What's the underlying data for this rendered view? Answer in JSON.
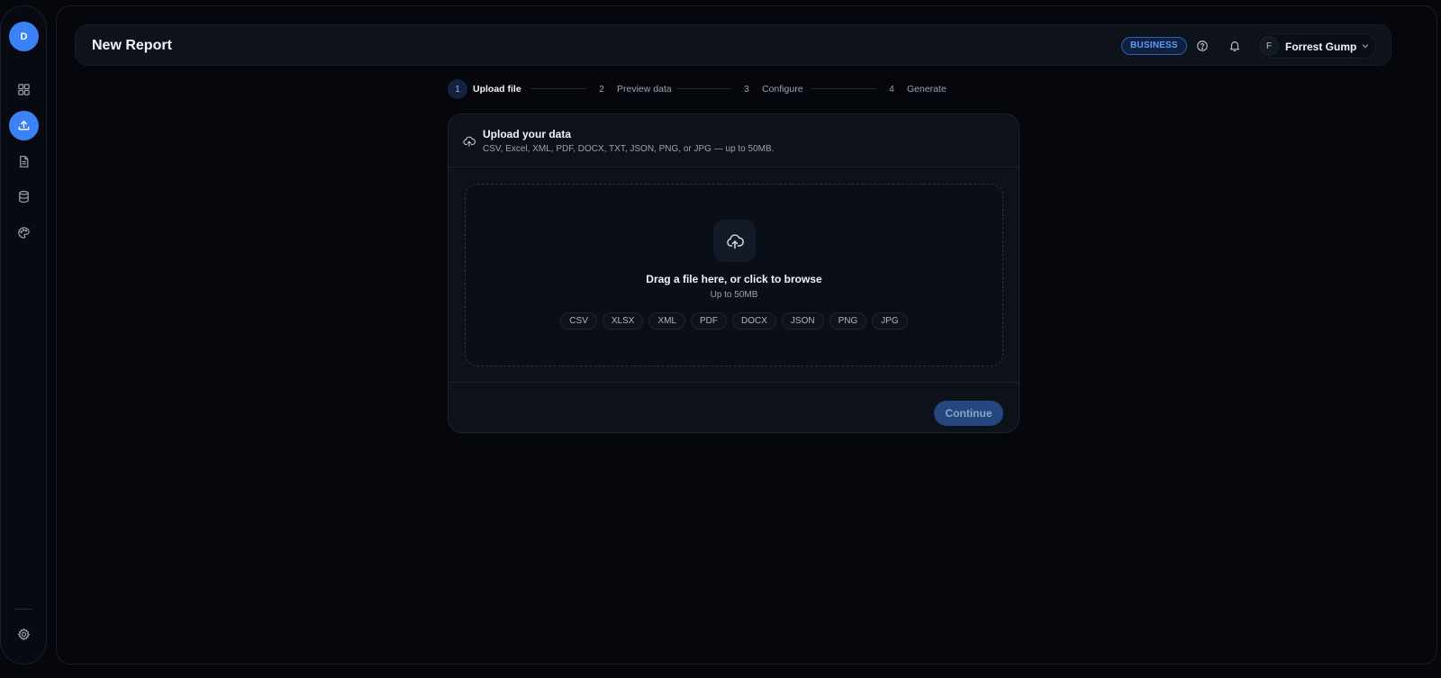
{
  "sidebar": {
    "logo_letter": "D",
    "items": [
      {
        "name": "dashboard",
        "icon": "grid-icon",
        "active": false
      },
      {
        "name": "upload",
        "icon": "upload-icon",
        "active": true
      },
      {
        "name": "reports",
        "icon": "document-icon",
        "active": false
      },
      {
        "name": "data-sources",
        "icon": "database-icon",
        "active": false
      },
      {
        "name": "themes",
        "icon": "palette-icon",
        "active": false
      }
    ],
    "settings_icon": "gear-icon"
  },
  "header": {
    "title": "New Report",
    "plan_badge": "BUSINESS",
    "help_icon": "help-circle-icon",
    "notifications_icon": "bell-icon",
    "user": {
      "initial": "F",
      "name": "Forrest Gump"
    }
  },
  "stepper": {
    "steps": [
      {
        "num": "1",
        "label": "Upload file",
        "active": true
      },
      {
        "num": "2",
        "label": "Preview data",
        "active": false
      },
      {
        "num": "3",
        "label": "Configure",
        "active": false
      },
      {
        "num": "4",
        "label": "Generate",
        "active": false
      }
    ]
  },
  "upload_card": {
    "title": "Upload your data",
    "subtitle": "CSV, Excel, XML, PDF, DOCX, TXT, JSON, PNG, or JPG — up to 50MB.",
    "dropzone": {
      "title": "Drag a file here, or click to browse",
      "subtitle": "Up to 50MB",
      "formats": [
        "CSV",
        "XLSX",
        "XML",
        "PDF",
        "DOCX",
        "JSON",
        "PNG",
        "JPG"
      ]
    },
    "continue_label": "Continue"
  },
  "colors": {
    "accent": "#3b82f6",
    "background": "#05070c",
    "card": "#0c111a",
    "badge_text": "#5c9cff"
  }
}
